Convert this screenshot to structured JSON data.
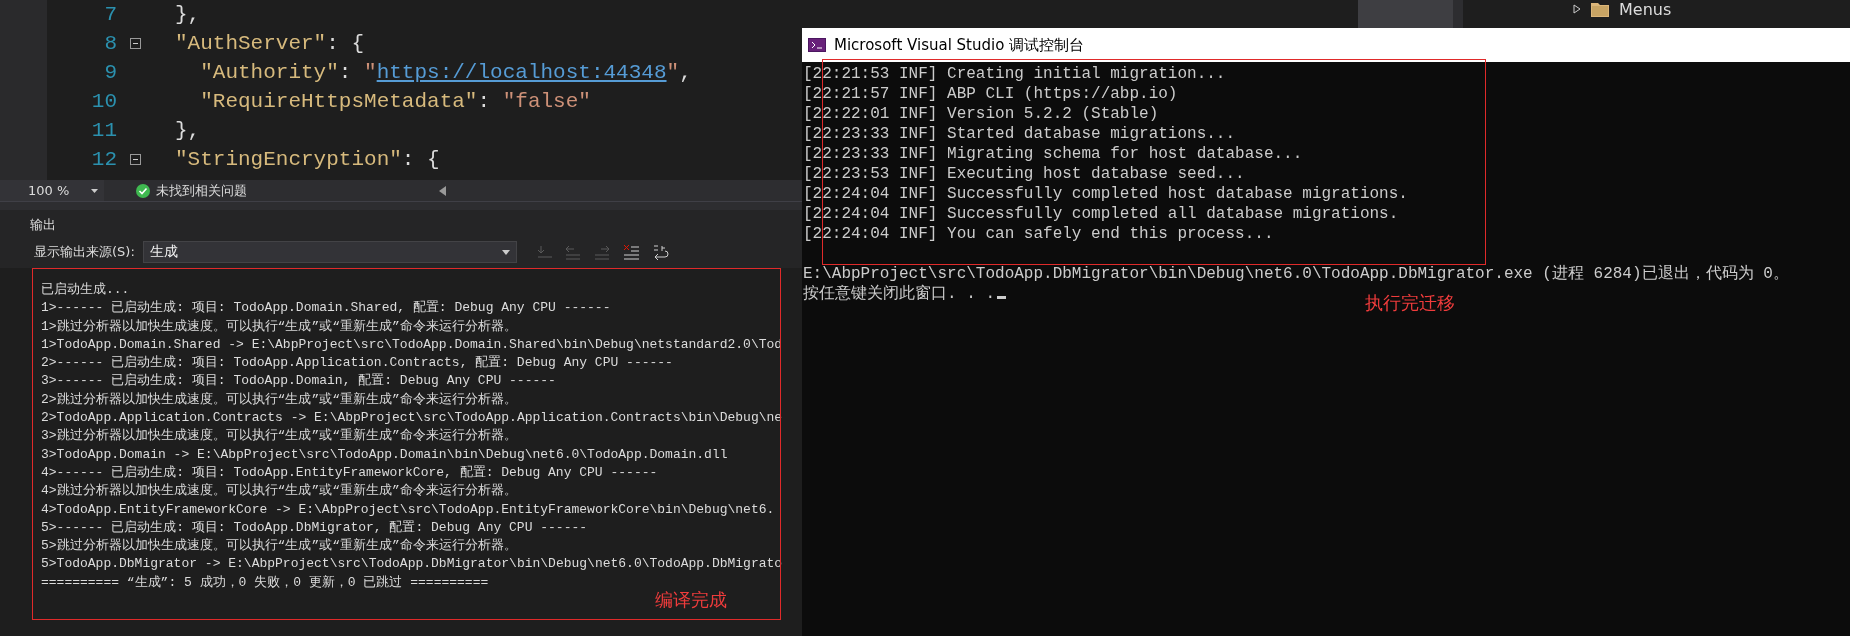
{
  "editor": {
    "lines": [
      {
        "number": "7",
        "foldable": false,
        "tokens": [
          {
            "kind": "punct",
            "text": "},"
          }
        ]
      },
      {
        "number": "8",
        "foldable": true,
        "tokens": [
          {
            "kind": "key",
            "text": "\"AuthServer\""
          },
          {
            "kind": "punct",
            "text": ": {"
          }
        ]
      },
      {
        "number": "9",
        "foldable": false,
        "tokens": [
          {
            "kind": "key",
            "text": "  \"Authority\""
          },
          {
            "kind": "punct",
            "text": ": "
          },
          {
            "kind": "string",
            "text": "\""
          },
          {
            "kind": "link",
            "text": "https://localhost:44348"
          },
          {
            "kind": "string",
            "text": "\""
          },
          {
            "kind": "punct",
            "text": ","
          }
        ]
      },
      {
        "number": "10",
        "foldable": false,
        "tokens": [
          {
            "kind": "key",
            "text": "  \"RequireHttpsMetadata\""
          },
          {
            "kind": "punct",
            "text": ": "
          },
          {
            "kind": "string",
            "text": "\"false\""
          }
        ]
      },
      {
        "number": "11",
        "foldable": false,
        "tokens": [
          {
            "kind": "punct",
            "text": "},"
          }
        ]
      },
      {
        "number": "12",
        "foldable": true,
        "tokens": [
          {
            "kind": "key",
            "text": "\"StringEncryption\""
          },
          {
            "kind": "punct",
            "text": ": {"
          }
        ]
      }
    ]
  },
  "status_bar": {
    "zoom": "100 %",
    "issues": "未找到相关问题"
  },
  "output": {
    "title": "输出",
    "source_label": "显示输出来源(S):",
    "source_value": "生成",
    "toolbar": [
      {
        "kind": "goto",
        "disabled": true
      },
      {
        "kind": "previous",
        "disabled": true
      },
      {
        "kind": "next",
        "disabled": true
      },
      {
        "kind": "clear",
        "disabled": false
      },
      {
        "kind": "wrap",
        "disabled": false
      }
    ],
    "lines": [
      "已启动生成...",
      "1>------ 已启动生成: 项目: TodoApp.Domain.Shared, 配置: Debug Any CPU ------",
      "1>跳过分析器以加快生成速度。可以执行“生成”或“重新生成”命令来运行分析器。",
      "1>TodoApp.Domain.Shared -> E:\\AbpProject\\src\\TodoApp.Domain.Shared\\bin\\Debug\\netstandard2.0\\Tod",
      "2>------ 已启动生成: 项目: TodoApp.Application.Contracts, 配置: Debug Any CPU ------",
      "3>------ 已启动生成: 项目: TodoApp.Domain, 配置: Debug Any CPU ------",
      "2>跳过分析器以加快生成速度。可以执行“生成”或“重新生成”命令来运行分析器。",
      "2>TodoApp.Application.Contracts -> E:\\AbpProject\\src\\TodoApp.Application.Contracts\\bin\\Debug\\ne",
      "3>跳过分析器以加快生成速度。可以执行“生成”或“重新生成”命令来运行分析器。",
      "3>TodoApp.Domain -> E:\\AbpProject\\src\\TodoApp.Domain\\bin\\Debug\\net6.0\\TodoApp.Domain.dll",
      "4>------ 已启动生成: 项目: TodoApp.EntityFrameworkCore, 配置: Debug Any CPU ------",
      "4>跳过分析器以加快生成速度。可以执行“生成”或“重新生成”命令来运行分析器。",
      "4>TodoApp.EntityFrameworkCore -> E:\\AbpProject\\src\\TodoApp.EntityFrameworkCore\\bin\\Debug\\net6.",
      "5>------ 已启动生成: 项目: TodoApp.DbMigrator, 配置: Debug Any CPU ------",
      "5>跳过分析器以加快生成速度。可以执行“生成”或“重新生成”命令来运行分析器。",
      "5>TodoApp.DbMigrator -> E:\\AbpProject\\src\\TodoApp.DbMigrator\\bin\\Debug\\net6.0\\TodoApp.DbMigrato",
      "========== “生成”: 5 成功，0 失败，0 更新，0 已跳过 =========="
    ],
    "annotation": "编译完成"
  },
  "solution_explorer": {
    "items": [
      {
        "label": "Menus",
        "expanded": false
      }
    ]
  },
  "console": {
    "title": "Microsoft Visual Studio 调试控制台",
    "lines": [
      "[22:21:53 INF] Creating initial migration...",
      "[22:21:57 INF] ABP CLI (https://abp.io)",
      "[22:22:01 INF] Version 5.2.2 (Stable)",
      "[22:23:33 INF] Started database migrations...",
      "[22:23:33 INF] Migrating schema for host database...",
      "[22:23:53 INF] Executing host database seed...",
      "[22:24:04 INF] Successfully completed host database migrations.",
      "[22:24:04 INF] Successfully completed all database migrations.",
      "[22:24:04 INF] You can safely end this process..."
    ],
    "exit_line": "E:\\AbpProject\\src\\TodoApp.DbMigrator\\bin\\Debug\\net6.0\\TodoApp.DbMigrator.exe (进程 6284)已退出，代码为 0。",
    "prompt": "按任意键关闭此窗口. . .",
    "annotation": "执行完迁移"
  }
}
